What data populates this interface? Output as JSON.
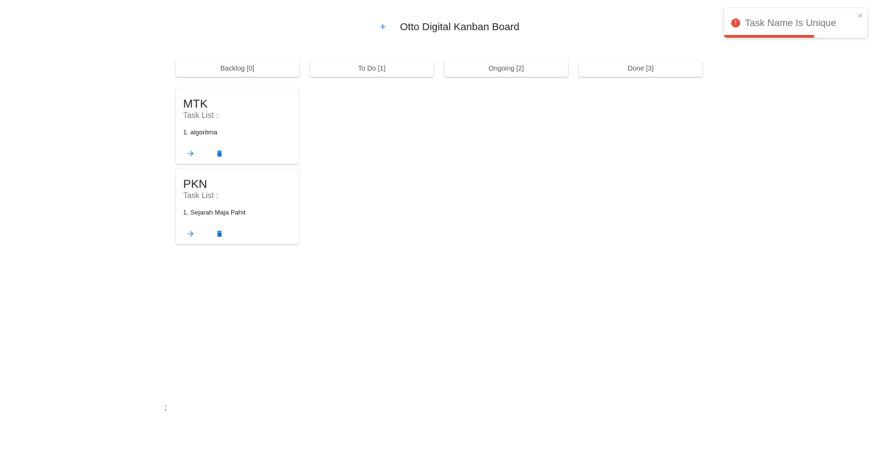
{
  "header": {
    "add_label": "+",
    "title": "Otto Digital Kanban Board"
  },
  "tabs": [
    {
      "label": "Backlog [0]"
    },
    {
      "label": "To Do [1]"
    },
    {
      "label": "Ongoing [2]"
    },
    {
      "label": "Done [3]"
    }
  ],
  "cards": [
    {
      "title": "MTK",
      "subtitle": "Task List :",
      "items": [
        "1. algoritma"
      ],
      "actions": {
        "next_icon": "arrow-right-icon",
        "delete_icon": "trash-icon"
      }
    },
    {
      "title": "PKN",
      "subtitle": "Task List :",
      "items": [
        "1. Sejarah Maja Pahit"
      ],
      "actions": {
        "next_icon": "arrow-right-icon",
        "delete_icon": "trash-icon"
      }
    }
  ],
  "toast": {
    "icon": "exclamation-icon",
    "icon_glyph": "!",
    "message": "Task Name Is Unique",
    "close_label": "×",
    "progress": 0.63,
    "color": "#e74c3c"
  },
  "stray_text": ";",
  "colors": {
    "accent": "#1976d2",
    "error": "#e74c3c"
  }
}
